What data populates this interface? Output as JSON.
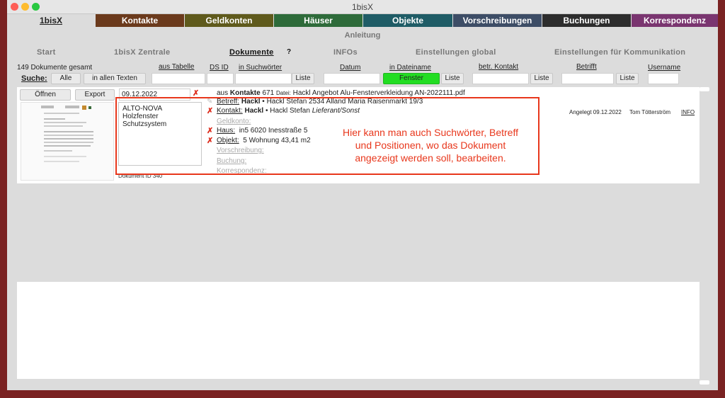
{
  "window": {
    "title": "1bisX"
  },
  "tabs": {
    "home": "1bisX",
    "kontakte": "Kontakte",
    "geldkonten": "Geldkonten",
    "haeuser": "Häuser",
    "objekte": "Objekte",
    "vorschreibungen": "Vorschreibungen",
    "buchungen": "Buchungen",
    "korrespondenz": "Korrespondenz"
  },
  "colors": {
    "kontakte": "#6b3a1c",
    "geldkonten": "#5f5a1c",
    "haeuser": "#2e6b3a",
    "objekte": "#1f5c66",
    "vorschreibungen": "#3d4d66",
    "buchungen": "#2d2d2d",
    "korrespondenz": "#7a3570",
    "annotation": "#e8371c",
    "fenster_button": "#22dd22"
  },
  "anleitung": "Anleitung",
  "nav": {
    "start": "Start",
    "zentrale": "1bisX Zentrale",
    "dokumente": "Dokumente",
    "help": "?",
    "infos": "INFOs",
    "einstellungen_global": "Einstellungen global",
    "einstellungen_kommunikation": "Einstellungen für Kommunikation"
  },
  "filter": {
    "count_label": "149 Dokumente gesamt",
    "suche": "Suche:",
    "alle": "Alle",
    "in_allen_texten": "in allen Texten",
    "aus_tabelle": "aus Tabelle",
    "ds_id": "DS ID",
    "in_suchwoertern": "in Suchwörter",
    "liste": "Liste",
    "datum": "Datum",
    "in_dateiname": "in Dateiname",
    "fenster": "Fenster",
    "betr_kontakt": "betr. Kontakt",
    "betrifft": "Betrifft",
    "username": "Username"
  },
  "record": {
    "oeffnen": "Öffnen",
    "export": "Export",
    "date": "09.12.2022",
    "keywords": [
      "ALTO-NOVA",
      "Holzfenster",
      "Schutzsystem"
    ],
    "doc_id": "Dokument ID 340",
    "source_prefix": "aus",
    "source_table": "Kontakte",
    "source_nr": "671",
    "file_label": "Datei:",
    "file_name": "Hackl Angebot Alu-Fensterverkleidung AN-2022111.pdf",
    "betreff_label": "Betreff:",
    "betreff_name": "Hackl",
    "betreff_rest": " • Hackl Stefan 2534 Alland Maria Raisenmarkt 19/3",
    "kontakt_label": "Kontakt:",
    "kontakt_name": "Hackl",
    "kontakt_rest": " • Hackl Stefan ",
    "kontakt_role": "Lieferant/Sonst",
    "geldkonto_label": "Geldkonto:",
    "haus_label": "Haus:",
    "haus_value": "in5  6020  Inesstraße 5",
    "objekt_label": "Objekt:",
    "objekt_value": "5 Wohnung 43,41 m2",
    "vorschreibung_label": "Vorschreibung:",
    "buchung_label": "Buchung:",
    "korrespondenz_label": "Korrespondenz:",
    "angelegt": "Angelegt 09.12.2022",
    "user": "Tom Tötterström",
    "info": "INFO"
  },
  "annotation": {
    "line1": "Hier kann man auch Suchwörter, Betreff",
    "line2": "und Positionen, wo das Dokument",
    "line3": "angezeigt werden soll, bearbeiten."
  }
}
